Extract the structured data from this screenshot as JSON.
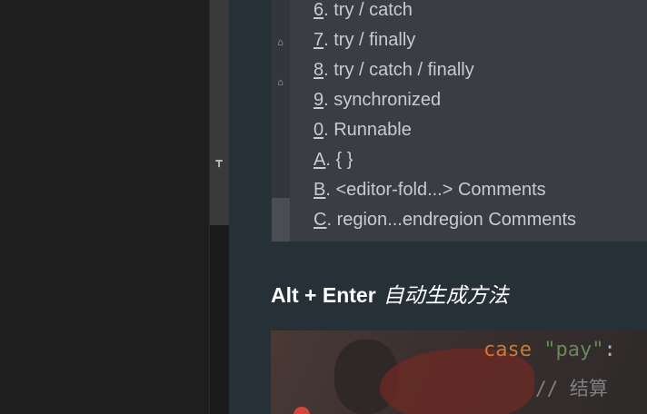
{
  "surround_menu": {
    "items": [
      {
        "key": "6",
        "label": ". try / catch"
      },
      {
        "key": "7",
        "label": ". try / finally"
      },
      {
        "key": "8",
        "label": ". try / catch / finally"
      },
      {
        "key": "9",
        "label": ". synchronized"
      },
      {
        "key": "0",
        "label": ". Runnable"
      },
      {
        "key": "A",
        "label": ". { }"
      },
      {
        "key": "B",
        "label": ". <editor-fold...> Comments"
      },
      {
        "key": "C",
        "label": ". region...endregion Comments"
      }
    ]
  },
  "section": {
    "shortcut": "Alt + Enter",
    "description": "自动生成方法"
  },
  "code": {
    "keyword": "case",
    "string": "\"pay\"",
    "punct": ":",
    "comment": "// 结算"
  }
}
